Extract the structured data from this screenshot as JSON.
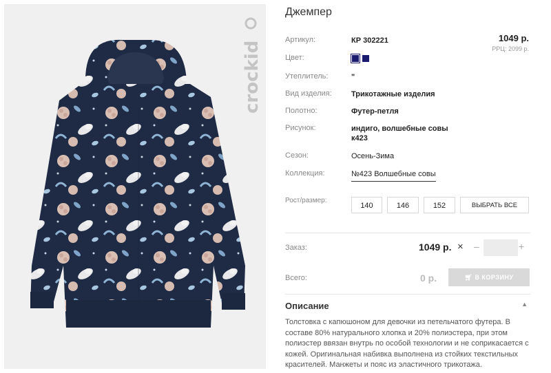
{
  "product": {
    "title": "Джемпер",
    "price": "1049 р.",
    "rrp": "РРЦ: 2099 р.",
    "brand": "crockid"
  },
  "attributes": {
    "article_label": "Артикул:",
    "article_value": "КР 302221",
    "color_label": "Цвет:",
    "colors": [
      "#1a1b6e",
      "#1a1b6e"
    ],
    "insulation_label": "Утеплитель:",
    "insulation_value": "\"",
    "type_label": "Вид изделия:",
    "type_value": "Трикотажные изделия",
    "fabric_label": "Полотно:",
    "fabric_value": "Футер-петля",
    "pattern_label": "Рисунок:",
    "pattern_value_line1": "индиго, волшебные совы",
    "pattern_value_line2": "к423",
    "season_label": "Сезон:",
    "season_value": "Осень-Зима",
    "collection_label": "Коллекция:",
    "collection_value": "№423 Волшебные совы"
  },
  "sizes": {
    "label": "Рост/размер:",
    "options": [
      "140",
      "146",
      "152"
    ],
    "select_all": "ВЫБРАТЬ ВСЕ"
  },
  "order": {
    "label": "Заказ:",
    "unit_price": "1049 р.",
    "times": "×",
    "minus": "–",
    "qty_value": "",
    "plus": "+"
  },
  "total": {
    "label": "Всего:",
    "value": "0 р.",
    "cart_button": "В КОРЗИНУ"
  },
  "description": {
    "title": "Описание",
    "text": "Толстовка с капюшоном для девочки из петельчатого футера. В составе 80% натурального хлопка и 20% полиэстера, при этом полиэстер ввязан внутрь по особой технологии и не соприкасается с кожей. Оригинальная набивка выполнена из стойких текстильных красителей. Манжеты и пояс из эластичного трикотажа."
  }
}
